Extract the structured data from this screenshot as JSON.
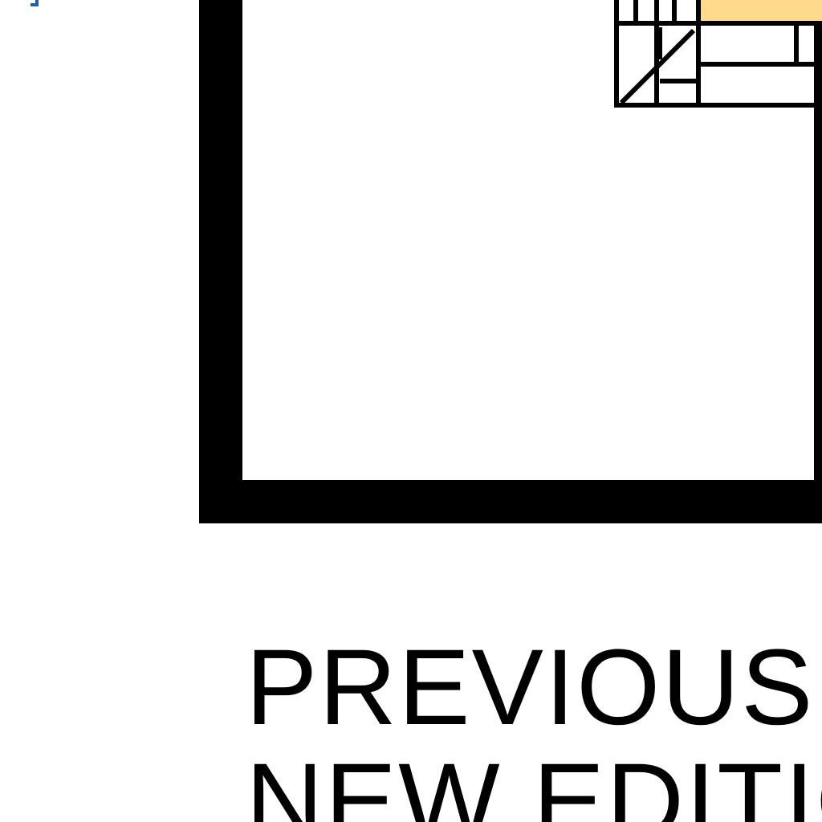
{
  "document": {
    "caption_line_1": "PREVIOUS E",
    "caption_line_2": "NEW EDITIO"
  },
  "colors": {
    "frame": "#000000",
    "highlight": "#ffd98c",
    "corner_mark": "#1f5fa8"
  },
  "icons": {
    "corner_mark": "corner-mark-icon",
    "form_graphic": "form-grid-icon"
  }
}
